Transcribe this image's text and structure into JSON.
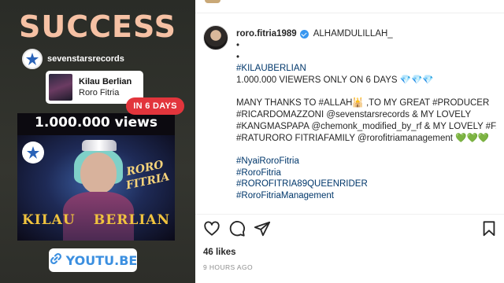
{
  "story": {
    "title": "SUCCESS",
    "repost_account": "sevenstarsrecords",
    "music_title": "Kilau Berlian",
    "music_artist": "Roro Fitria",
    "days_badge": "IN 6 DAYS",
    "views_text": "1.000.000 views",
    "video_overlay_name": "RORO FITRIA",
    "song_word_1": "KILAU",
    "song_word_2": "BERLIAN",
    "link_text": "YOUTU.BE",
    "accent_color": "#e2353c",
    "title_color": "#f6c1a4"
  },
  "post": {
    "username": "roro.fitria1989",
    "first_line": "ALHAMDULILLAH_",
    "bullets": [
      "•",
      "•"
    ],
    "hashtag_title": "#KILAUBERLIAN",
    "views_line": "1.000.000 VIEWERS ONLY ON 6 DAYS 💎💎💎",
    "thanks_lines": [
      "MANY THANKS TO #ALLAH🕌 ,TO MY GREAT #PRODUCER",
      "#RICARDOMAZZONI @sevenstarsrecords & MY LOVELY",
      "#KANGMASPAPA @chemonk_modified_by_rf & MY LOVELY #FANS",
      "#RATURORO FITRIAFAMILY @rorofitriamanagement 💚💚💚"
    ],
    "tags": [
      "#NyaiRoroFitria",
      "#RoroFitria",
      "#ROROFITRIA89QUEENRIDER",
      "#RoroFitriaManagement"
    ],
    "likes": "46 likes",
    "timestamp": "9 HOURS AGO",
    "icons": [
      "heart-icon",
      "comment-icon",
      "share-icon",
      "bookmark-icon"
    ],
    "link_color": "#00376b"
  }
}
